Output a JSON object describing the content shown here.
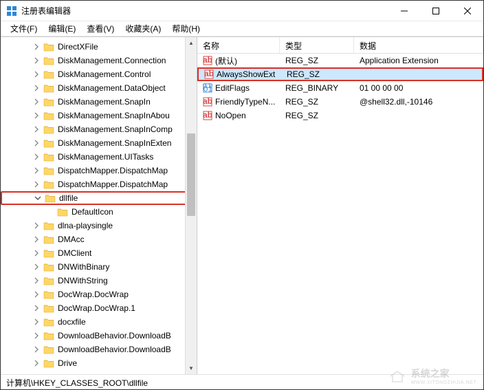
{
  "window": {
    "title": "注册表编辑器"
  },
  "menu": {
    "file": "文件(F)",
    "edit": "编辑(E)",
    "view": "查看(V)",
    "favorites": "收藏夹(A)",
    "help": "帮助(H)"
  },
  "tree": {
    "items": [
      {
        "label": "DirectXFile",
        "expandable": true
      },
      {
        "label": "DiskManagement.Connection",
        "expandable": true
      },
      {
        "label": "DiskManagement.Control",
        "expandable": true
      },
      {
        "label": "DiskManagement.DataObject",
        "expandable": true
      },
      {
        "label": "DiskManagement.SnapIn",
        "expandable": true
      },
      {
        "label": "DiskManagement.SnapInAbou",
        "expandable": true
      },
      {
        "label": "DiskManagement.SnapInComp",
        "expandable": true
      },
      {
        "label": "DiskManagement.SnapInExten",
        "expandable": true
      },
      {
        "label": "DiskManagement.UITasks",
        "expandable": true
      },
      {
        "label": "DispatchMapper.DispatchMap",
        "expandable": true
      },
      {
        "label": "DispatchMapper.DispatchMap",
        "expandable": true
      },
      {
        "label": "dllfile",
        "expandable": true,
        "expanded": true,
        "highlighted": true
      },
      {
        "label": "DefaultIcon",
        "expandable": false,
        "child": true
      },
      {
        "label": "dlna-playsingle",
        "expandable": true
      },
      {
        "label": "DMAcc",
        "expandable": true
      },
      {
        "label": "DMClient",
        "expandable": true
      },
      {
        "label": "DNWithBinary",
        "expandable": true
      },
      {
        "label": "DNWithString",
        "expandable": true
      },
      {
        "label": "DocWrap.DocWrap",
        "expandable": true
      },
      {
        "label": "DocWrap.DocWrap.1",
        "expandable": true
      },
      {
        "label": "docxfile",
        "expandable": true
      },
      {
        "label": "DownloadBehavior.DownloadB",
        "expandable": true
      },
      {
        "label": "DownloadBehavior.DownloadB",
        "expandable": true
      },
      {
        "label": "Drive",
        "expandable": true
      }
    ]
  },
  "list": {
    "headers": {
      "name": "名称",
      "type": "类型",
      "data": "数据"
    },
    "rows": [
      {
        "name": "(默认)",
        "type": "REG_SZ",
        "data": "Application Extension",
        "icon": "string"
      },
      {
        "name": "AlwaysShowExt",
        "type": "REG_SZ",
        "data": "",
        "icon": "string",
        "selected": true,
        "highlighted": true
      },
      {
        "name": "EditFlags",
        "type": "REG_BINARY",
        "data": "01 00 00 00",
        "icon": "binary"
      },
      {
        "name": "FriendlyTypeN...",
        "type": "REG_SZ",
        "data": "@shell32.dll,-10146",
        "icon": "string"
      },
      {
        "name": "NoOpen",
        "type": "REG_SZ",
        "data": "",
        "icon": "string"
      }
    ]
  },
  "statusbar": {
    "path": "计算机\\HKEY_CLASSES_ROOT\\dllfile"
  },
  "watermark": {
    "text": "系统之家",
    "url": "WWW.XITONGZHIJIA.NET"
  }
}
